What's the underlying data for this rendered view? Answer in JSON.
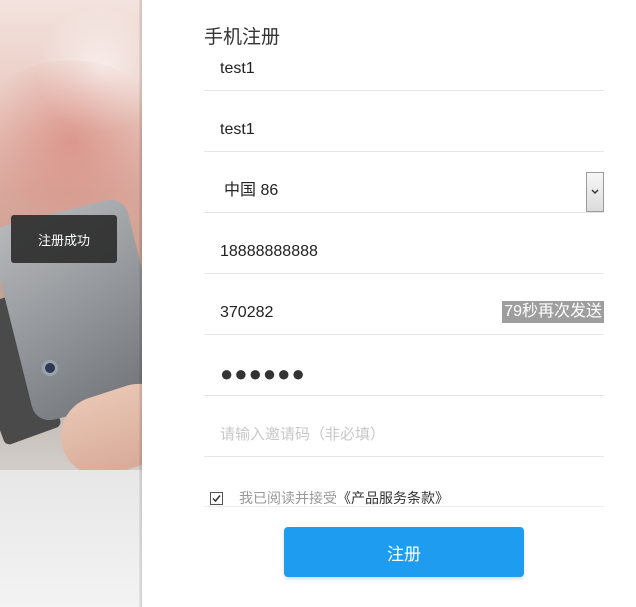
{
  "toast": {
    "text": "注册成功"
  },
  "form": {
    "title": "手机注册",
    "username": "test1",
    "nickname": "test1",
    "country": "中国 86",
    "phone": "18888888888",
    "sms_code": "370282",
    "resend_label": "79秒再次发送",
    "password_mask": "●●●●●●",
    "invite_placeholder": "请输入邀请码（非必填）",
    "agree_prefix": "我已阅读并接受",
    "agree_terms": "《产品服务条款》",
    "submit_label": "注册"
  },
  "colors": {
    "primary": "#1e9cf0",
    "resend_bg": "#9e9e9e"
  },
  "icons": {
    "select": "chevron-down-icon",
    "checkbox": "checkmark-icon"
  }
}
